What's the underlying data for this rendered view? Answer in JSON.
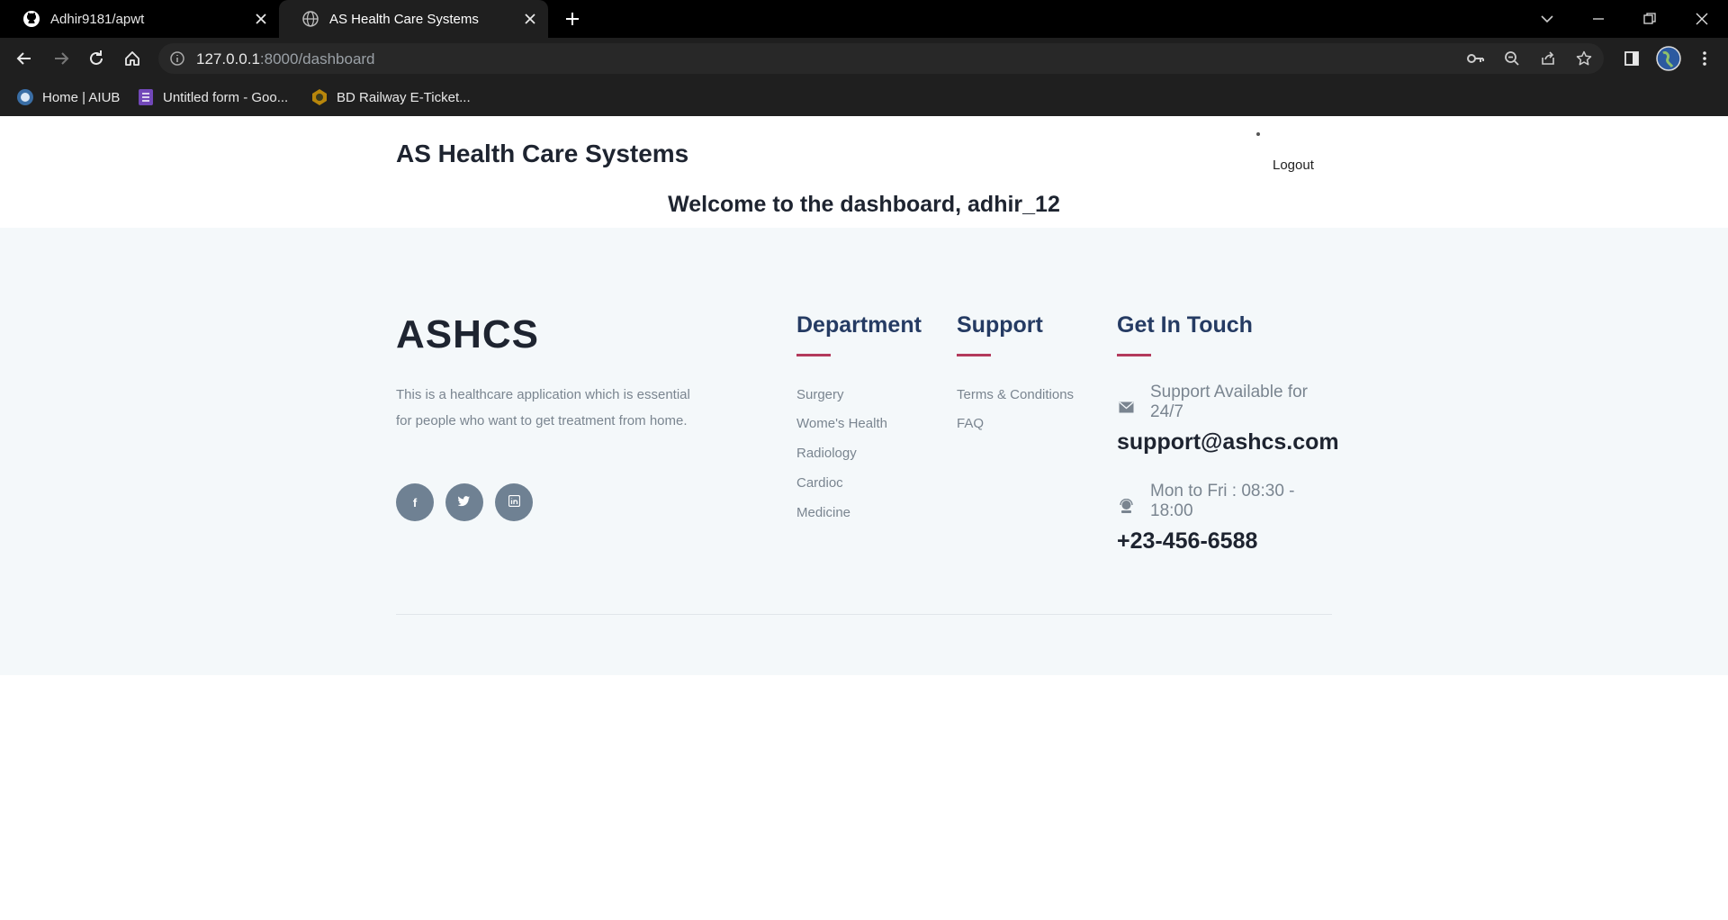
{
  "browser": {
    "tabs": [
      {
        "title": "Adhir9181/apwt"
      },
      {
        "title": "AS Health Care Systems"
      }
    ],
    "url_host": "127.0.0.1",
    "url_rest": ":8000/dashboard",
    "bookmarks": [
      {
        "label": "Home | AIUB"
      },
      {
        "label": "Untitled form - Goo..."
      },
      {
        "label": "BD Railway E-Ticket..."
      }
    ]
  },
  "header": {
    "brand": "AS Health Care Systems",
    "logout_label": "Logout",
    "welcome": "Welcome to the dashboard, adhir_12"
  },
  "footer": {
    "logo": "ASHCS",
    "description": "This is a healthcare application which is essential for people who want to get treatment from home.",
    "social": [
      {
        "label": "f"
      },
      {
        "label": "t"
      },
      {
        "label": "in"
      }
    ],
    "department": {
      "heading": "Department",
      "links": [
        "Surgery",
        "Wome's Health",
        "Radiology",
        "Cardioc",
        "Medicine"
      ]
    },
    "support": {
      "heading": "Support",
      "links": [
        "Terms & Conditions",
        "FAQ"
      ]
    },
    "contact": {
      "heading": "Get In Touch",
      "support_label": "Support Available for 24/7",
      "email": "support@ashcs.com",
      "hours_label": "Mon to Fri : 08:30 - 18:00",
      "phone": "+23-456-6588"
    }
  },
  "colors": {
    "heading_blue": "#253b63",
    "accent": "#b33a5c",
    "footer_bg": "#f4f8fa",
    "social_bg": "#6f8193"
  }
}
